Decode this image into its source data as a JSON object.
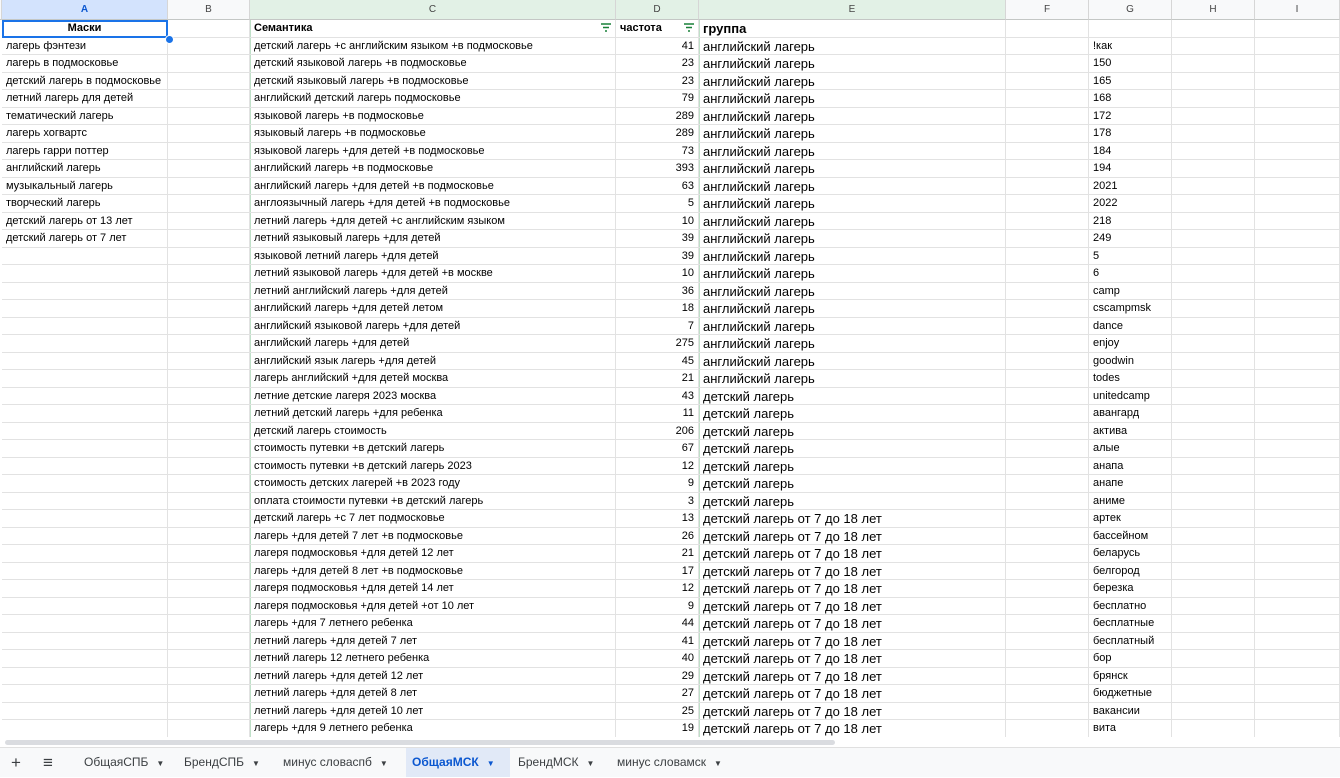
{
  "columns": [
    {
      "letter": "A",
      "label": "A"
    },
    {
      "letter": "B",
      "label": "B"
    },
    {
      "letter": "C",
      "label": "C"
    },
    {
      "letter": "D",
      "label": "D"
    },
    {
      "letter": "E",
      "label": "E"
    },
    {
      "letter": "F",
      "label": "F"
    },
    {
      "letter": "G",
      "label": "G"
    },
    {
      "letter": "H",
      "label": "H"
    },
    {
      "letter": "I",
      "label": "I"
    }
  ],
  "header": {
    "masks": "Маски",
    "semantics": "Семантика",
    "frequency": "частота",
    "group": "группа"
  },
  "masks": [
    "лагерь фэнтези",
    "лагерь в подмосковье",
    "детский лагерь в подмосковье",
    "летний лагерь для детей",
    "тематический лагерь",
    "лагерь хогвартс",
    "лагерь гарри поттер",
    "английский лагерь",
    "музыкальный лагерь",
    "творческий лагерь",
    "детский лагерь от 13 лет",
    "детский лагерь от 7 лет"
  ],
  "rows": [
    {
      "sem": "детский лагерь +с английским языком +в подмосковье",
      "freq": "41",
      "group": "английский лагерь",
      "g": "!как"
    },
    {
      "sem": "детский языковой лагерь +в подмосковье",
      "freq": "23",
      "group": "английский лагерь",
      "g": "150"
    },
    {
      "sem": "детский языковый лагерь +в подмосковье",
      "freq": "23",
      "group": "английский лагерь",
      "g": "165"
    },
    {
      "sem": "английский детский лагерь подмосковье",
      "freq": "79",
      "group": "английский лагерь",
      "g": "168"
    },
    {
      "sem": "языковой лагерь +в подмосковье",
      "freq": "289",
      "group": "английский лагерь",
      "g": "172"
    },
    {
      "sem": "языковый лагерь +в подмосковье",
      "freq": "289",
      "group": "английский лагерь",
      "g": "178"
    },
    {
      "sem": "языковой лагерь +для детей +в подмосковье",
      "freq": "73",
      "group": "английский лагерь",
      "g": "184"
    },
    {
      "sem": "английский лагерь +в подмосковье",
      "freq": "393",
      "group": "английский лагерь",
      "g": "194"
    },
    {
      "sem": "английский лагерь +для детей +в подмосковье",
      "freq": "63",
      "group": "английский лагерь",
      "g": "2021"
    },
    {
      "sem": "англоязычный лагерь +для детей +в подмосковье",
      "freq": "5",
      "group": "английский лагерь",
      "g": "2022"
    },
    {
      "sem": "летний лагерь +для детей +с английским языком",
      "freq": "10",
      "group": "английский лагерь",
      "g": "218"
    },
    {
      "sem": "летний языковый лагерь +для детей",
      "freq": "39",
      "group": "английский лагерь",
      "g": "249"
    },
    {
      "sem": "языковой летний лагерь +для детей",
      "freq": "39",
      "group": "английский лагерь",
      "g": "5"
    },
    {
      "sem": "летний языковой лагерь +для детей +в москве",
      "freq": "10",
      "group": "английский лагерь",
      "g": "6"
    },
    {
      "sem": "летний английский лагерь +для детей",
      "freq": "36",
      "group": "английский лагерь",
      "g": "camp"
    },
    {
      "sem": "английский лагерь +для детей летом",
      "freq": "18",
      "group": "английский лагерь",
      "g": "cscampmsk"
    },
    {
      "sem": "английский языковой лагерь +для детей",
      "freq": "7",
      "group": "английский лагерь",
      "g": "dance"
    },
    {
      "sem": "английский лагерь +для детей",
      "freq": "275",
      "group": "английский лагерь",
      "g": "enjoy"
    },
    {
      "sem": "английский язык лагерь +для детей",
      "freq": "45",
      "group": "английский лагерь",
      "g": "goodwin"
    },
    {
      "sem": "лагерь английский +для детей москва",
      "freq": "21",
      "group": "английский лагерь",
      "g": "todes"
    },
    {
      "sem": "летние детские лагеря 2023 москва",
      "freq": "43",
      "group": "детский лагерь",
      "g": "unitedcamp"
    },
    {
      "sem": "летний детский лагерь +для ребенка",
      "freq": "11",
      "group": "детский лагерь",
      "g": "авангард"
    },
    {
      "sem": "детский лагерь стоимость",
      "freq": "206",
      "group": "детский лагерь",
      "g": "актива"
    },
    {
      "sem": "стоимость путевки +в детский лагерь",
      "freq": "67",
      "group": "детский лагерь",
      "g": "алые"
    },
    {
      "sem": "стоимость путевки +в детский лагерь 2023",
      "freq": "12",
      "group": "детский лагерь",
      "g": "анапа"
    },
    {
      "sem": "стоимость детских лагерей +в 2023 году",
      "freq": "9",
      "group": "детский лагерь",
      "g": "анапе"
    },
    {
      "sem": "оплата стоимости путевки +в детский лагерь",
      "freq": "3",
      "group": "детский лагерь",
      "g": "аниме"
    },
    {
      "sem": "детский лагерь +с 7 лет подмосковье",
      "freq": "13",
      "group": "детский лагерь от 7 до 18 лет",
      "g": "артек"
    },
    {
      "sem": "лагерь +для детей 7 лет +в подмосковье",
      "freq": "26",
      "group": "детский лагерь от 7 до 18 лет",
      "g": "бассейном"
    },
    {
      "sem": "лагеря подмосковья +для детей 12 лет",
      "freq": "21",
      "group": "детский лагерь от 7 до 18 лет",
      "g": "беларусь"
    },
    {
      "sem": "лагерь +для детей 8 лет +в подмосковье",
      "freq": "17",
      "group": "детский лагерь от 7 до 18 лет",
      "g": "белгород"
    },
    {
      "sem": "лагеря подмосковья +для детей 14 лет",
      "freq": "12",
      "group": "детский лагерь от 7 до 18 лет",
      "g": "березка"
    },
    {
      "sem": "лагеря подмосковья +для детей +от 10 лет",
      "freq": "9",
      "group": "детский лагерь от 7 до 18 лет",
      "g": "бесплатно"
    },
    {
      "sem": "лагерь +для 7 летнего ребенка",
      "freq": "44",
      "group": "детский лагерь от 7 до 18 лет",
      "g": "бесплатные"
    },
    {
      "sem": "летний лагерь +для детей 7 лет",
      "freq": "41",
      "group": "детский лагерь от 7 до 18 лет",
      "g": "бесплатный"
    },
    {
      "sem": "летний лагерь 12 летнего ребенка",
      "freq": "40",
      "group": "детский лагерь от 7 до 18 лет",
      "g": "бор"
    },
    {
      "sem": "летний лагерь +для детей 12 лет",
      "freq": "29",
      "group": "детский лагерь от 7 до 18 лет",
      "g": "брянск"
    },
    {
      "sem": "летний лагерь +для детей 8 лет",
      "freq": "27",
      "group": "детский лагерь от 7 до 18 лет",
      "g": "бюджетные"
    },
    {
      "sem": "летний лагерь +для детей 10 лет",
      "freq": "25",
      "group": "детский лагерь от 7 до 18 лет",
      "g": "вакансии"
    },
    {
      "sem": "лагерь +для 9 летнего ребенка",
      "freq": "19",
      "group": "детский лагерь от 7 до 18 лет",
      "g": "вита"
    }
  ],
  "tabs": [
    {
      "label": "ОбщаяСПБ",
      "active": false
    },
    {
      "label": "БрендСПБ",
      "active": false
    },
    {
      "label": "минус словаспб",
      "active": false
    },
    {
      "label": "ОбщаяМСК",
      "active": true
    },
    {
      "label": "БрендМСК",
      "active": false
    },
    {
      "label": "минус словамск",
      "active": false
    }
  ],
  "icons": {
    "add": "plus-icon",
    "menu": "hamburger-icon",
    "filter": "filter-icon",
    "dropdown": "caret-down-icon"
  },
  "colors": {
    "selection": "#1a73e8",
    "active_tab_bg": "#e1e9f7",
    "active_tab_text": "#0b57d0",
    "filter_icon": "#188038"
  }
}
